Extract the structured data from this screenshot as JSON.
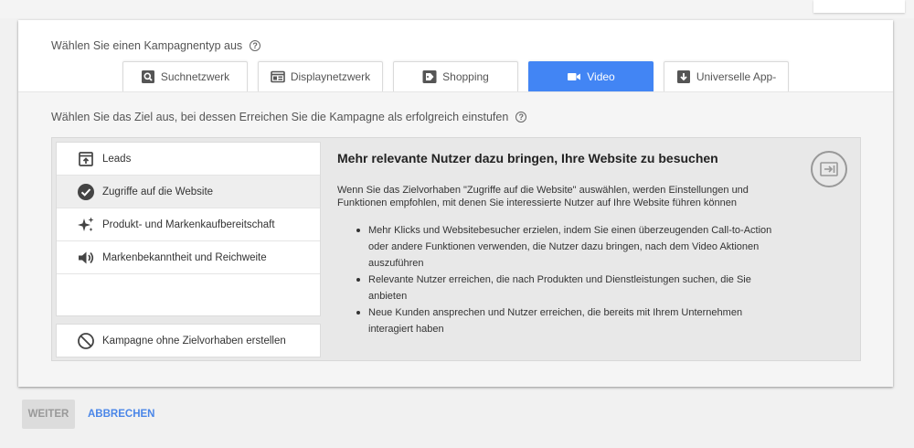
{
  "header": {
    "campaign_type_label": "Wählen Sie einen Kampagnentyp aus",
    "help": "?"
  },
  "tabs": [
    {
      "label": "Suchnetzwerk",
      "icon": "search-icon",
      "active": false
    },
    {
      "label": "Displaynetzwerk",
      "icon": "display-icon",
      "active": false
    },
    {
      "label": "Shopping",
      "icon": "tag-icon",
      "active": false
    },
    {
      "label": "Video",
      "icon": "video-camera-icon",
      "active": true
    },
    {
      "label": "Universelle App-",
      "icon": "app-download-icon",
      "active": false
    }
  ],
  "goal": {
    "label": "Wählen Sie das Ziel aus, bei dessen Erreichen Sie die Kampagne als erfolgreich einstufen",
    "help": "?"
  },
  "goals": [
    {
      "label": "Leads",
      "icon": "lead-form-icon"
    },
    {
      "label": "Zugriffe auf die Website",
      "icon": "check-circle-icon",
      "selected": true
    },
    {
      "label": "Produkt- und Markenkaufbereitschaft",
      "icon": "sparkle-icon"
    },
    {
      "label": "Markenbekanntheit und Reichweite",
      "icon": "speaker-icon"
    }
  ],
  "no_goal": {
    "label": "Kampagne ohne Zielvorhaben erstellen",
    "icon": "block-icon"
  },
  "detail": {
    "title": "Mehr relevante Nutzer dazu bringen, Ihre Website zu besuchen",
    "intro": "Wenn Sie das Zielvorhaben \"Zugriffe auf die Website\" auswählen, werden Einstellungen und Funktionen empfohlen, mit denen Sie interessierte Nutzer auf Ihre Website führen können",
    "bullets": [
      {
        "l1": "Mehr Klicks und Websitebesucher erzielen, indem Sie einen überzeugenden Call-to-Action",
        "l2": "oder andere Funktionen verwenden, die Nutzer dazu bringen, nach dem Video Aktionen",
        "l3": "auszuführen"
      },
      {
        "l1": "Relevante Nutzer erreichen, die nach Produkten und Dienstleistungen suchen, die Sie",
        "l2": "anbieten"
      },
      {
        "l1": "Neue Kunden ansprechen und Nutzer erreichen, die bereits mit Ihrem Unternehmen",
        "l2": "interagiert haben"
      }
    ],
    "corner_icon": "website-enter-icon"
  },
  "footer": {
    "next_label": "WEITER",
    "cancel_label": "ABBRECHEN"
  },
  "colors": {
    "accent": "#4285f4",
    "link": "#4a86e8"
  }
}
